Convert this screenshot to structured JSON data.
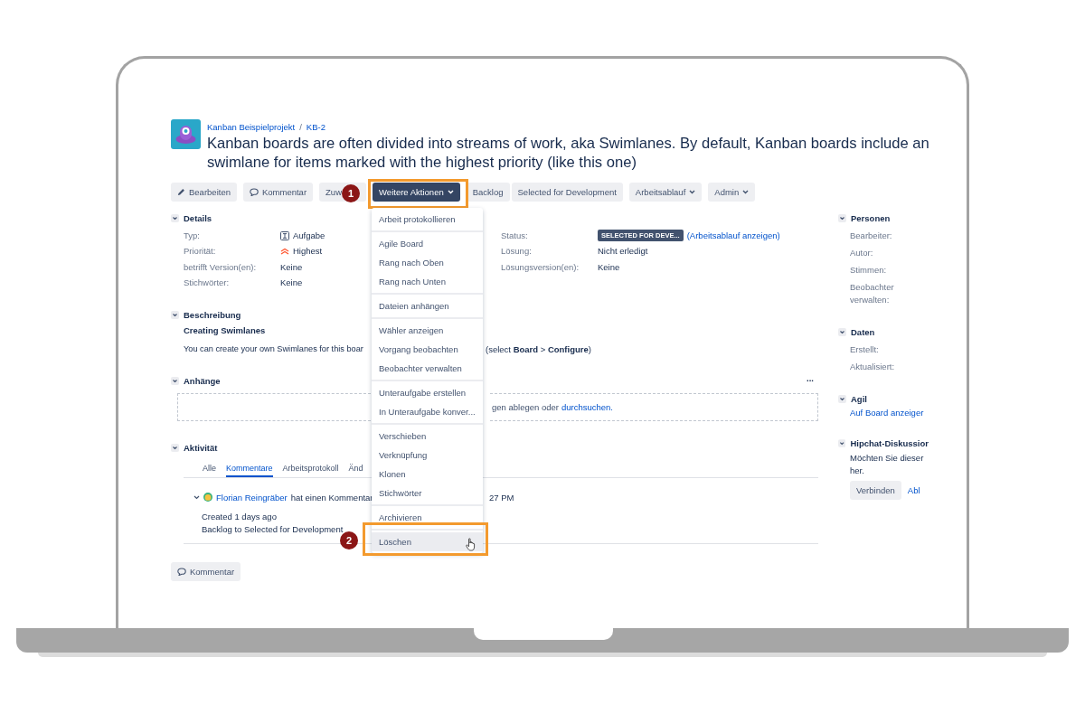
{
  "project": {
    "breadcrumb": [
      "Kanban Beispielprojekt",
      "KB-2"
    ],
    "title": "Kanban boards are often divided into streams of work, aka Swimlanes. By default, Kanban boards include an swimlane for items marked with the highest priority (like this one)"
  },
  "breadcrumb_separator": "/",
  "toolbar": [
    {
      "label": "Bearbeiten",
      "kind": "pencil",
      "dropdown": false,
      "selected": false
    },
    {
      "label": "Kommentar",
      "kind": "comment",
      "dropdown": false,
      "selected": false
    },
    {
      "label": "Zuw",
      "dropdown": false,
      "selected": false
    },
    {
      "label": "Weitere Aktionen",
      "dropdown": true,
      "selected": true
    },
    {
      "label": "Backlog",
      "dropdown": false,
      "selected": false
    },
    {
      "label": "Selected for Development",
      "dropdown": false,
      "selected": false
    },
    {
      "label": "Arbeitsablauf",
      "dropdown": true,
      "selected": false
    },
    {
      "label": "Admin",
      "dropdown": true,
      "selected": false
    }
  ],
  "steps": [
    "1",
    "2"
  ],
  "details": {
    "title": "Details",
    "left": [
      {
        "label": "Typ:",
        "value": "Aufgabe",
        "kind": "task"
      },
      {
        "label": "Priorität:",
        "value": "Highest",
        "kind": "priority"
      },
      {
        "label": "betrifft Version(en):",
        "value": "Keine",
        "kind": "text"
      },
      {
        "label": "Stichwörter:",
        "value": "Keine",
        "kind": "text"
      }
    ],
    "right": [
      {
        "label": "Status:",
        "value": "SELECTED FOR DEVE...",
        "link": "(Arbeitsablauf anzeigen)",
        "kind": "status"
      },
      {
        "label": "Lösung:",
        "value": "Nicht erledigt",
        "kind": "text"
      },
      {
        "label": "Lösungsversion(en):",
        "value": "Keine",
        "kind": "text"
      }
    ]
  },
  "description": {
    "title": "Beschreibung",
    "heading": "Creating Swimlanes",
    "text_before": "You can create your own Swimlanes for this boar",
    "text_after": "(select **Board** > **Configure**)"
  },
  "attachments": {
    "title": "Anhänge",
    "more": "...",
    "drop_text": "gen ablegen oder",
    "link": "durchsuchen."
  },
  "activity": {
    "title": "Aktivität",
    "tabs": [
      {
        "label": "Alle",
        "selected": false
      },
      {
        "label": "Kommentare",
        "selected": true
      },
      {
        "label": "Arbeitsprotokoll",
        "selected": false
      },
      {
        "label": "Änd",
        "selected": false
      }
    ],
    "comment": {
      "author": "Florian Reingräber",
      "action": "hat einen Kommentar",
      "time": "27 PM",
      "lines": [
        "Created 1 days ago",
        "Backlog to Selected for Development"
      ]
    }
  },
  "comment_button": "Kommentar",
  "dropdown_menu": {
    "sections": [
      [
        {
          "label": "Arbeit protokollieren",
          "hovered": false
        }
      ],
      [
        {
          "label": "Agile Board",
          "hovered": false
        },
        {
          "label": "Rang nach Oben",
          "hovered": false
        },
        {
          "label": "Rang nach Unten",
          "hovered": false
        }
      ],
      [
        {
          "label": "Dateien anhängen",
          "hovered": false
        }
      ],
      [
        {
          "label": "Wähler anzeigen",
          "hovered": false
        },
        {
          "label": "Vorgang beobachten",
          "hovered": false
        },
        {
          "label": "Beobachter verwalten",
          "hovered": false
        }
      ],
      [
        {
          "label": "Unteraufgabe erstellen",
          "hovered": false
        },
        {
          "label": "In Unteraufgabe konver...",
          "hovered": false
        }
      ],
      [
        {
          "label": "Verschieben",
          "hovered": false
        },
        {
          "label": "Verknüpfung",
          "hovered": false
        },
        {
          "label": "Klonen",
          "hovered": false
        },
        {
          "label": "Stichwörter",
          "hovered": false
        }
      ],
      [
        {
          "label": "Archivieren",
          "hovered": false
        }
      ],
      [
        {
          "label": "Löschen",
          "hovered": true
        }
      ]
    ]
  },
  "sidebar": [
    {
      "title": "Personen",
      "fields": [
        "Bearbeiter:",
        "Autor:",
        "Stimmen:",
        "Beobachter verwalten:"
      ]
    },
    {
      "title": "Daten",
      "fields": [
        "Erstellt:",
        "Aktualisiert:"
      ]
    },
    {
      "title": "Agil",
      "link": "Auf Board anzeiger"
    },
    {
      "title": "Hipchat-Diskussior",
      "lines": [
        "Möchten Sie dieser",
        "her."
      ],
      "button": "Verbinden",
      "link": "Abl"
    }
  ]
}
